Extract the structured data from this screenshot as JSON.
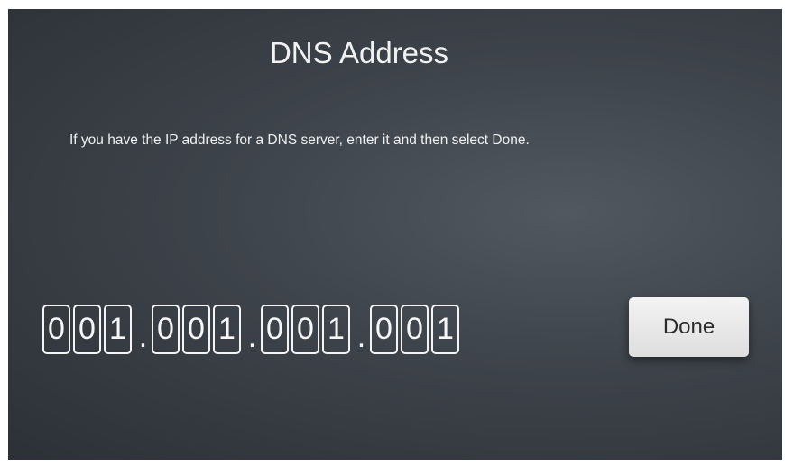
{
  "dialog": {
    "title": "DNS Address",
    "instructions": "If you have the IP address for a DNS server, enter it and then select Done."
  },
  "ip_address": {
    "octets": [
      {
        "digits": [
          "0",
          "0",
          "1"
        ]
      },
      {
        "digits": [
          "0",
          "0",
          "1"
        ]
      },
      {
        "digits": [
          "0",
          "0",
          "1"
        ]
      },
      {
        "digits": [
          "0",
          "0",
          "1"
        ]
      }
    ],
    "separator": "."
  },
  "actions": {
    "done_label": "Done"
  },
  "colors": {
    "background": "#3d434a",
    "text": "#f2f2f2",
    "button_background": "#e9e9e9",
    "button_text": "#2b2b2b"
  }
}
